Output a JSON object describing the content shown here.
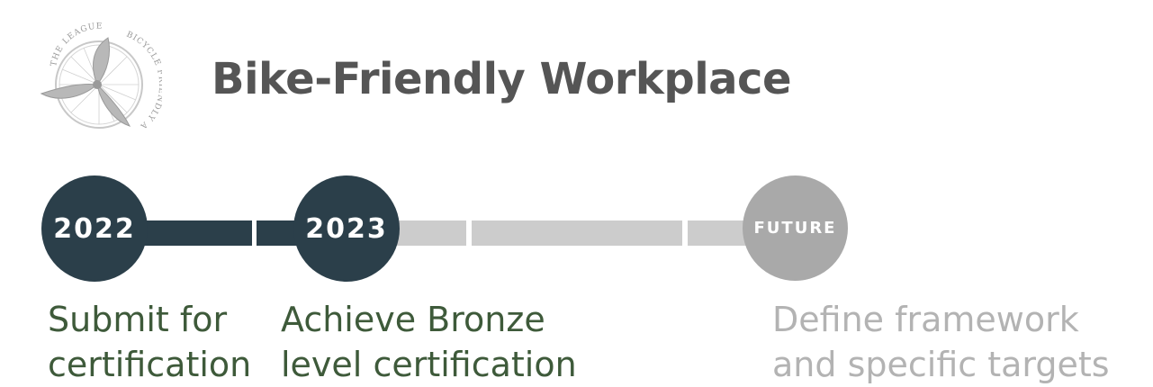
{
  "logo": {
    "text_top": "THE LEAGUE",
    "text_right": "BICYCLE FRIENDLY AMERICA",
    "icon": "bicycle-wheel-wings-icon"
  },
  "title": "Bike-Friendly Workplace",
  "timeline": {
    "milestones": [
      {
        "label": "2022",
        "desc_line1": "Submit for",
        "desc_line2": "certification",
        "status": "done"
      },
      {
        "label": "2023",
        "desc_line1": "Achieve Bronze",
        "desc_line2": "level certification",
        "status": "done"
      },
      {
        "label": "FUTURE",
        "desc_line1": "Define framework",
        "desc_line2": "and specific targets",
        "status": "future"
      }
    ]
  },
  "colors": {
    "done": "#2b3f4a",
    "future_node": "#a9a9a9",
    "future_track": "#cccccc",
    "done_text": "#3e5a3a",
    "future_text": "#b3b3b3",
    "title": "#555555"
  }
}
